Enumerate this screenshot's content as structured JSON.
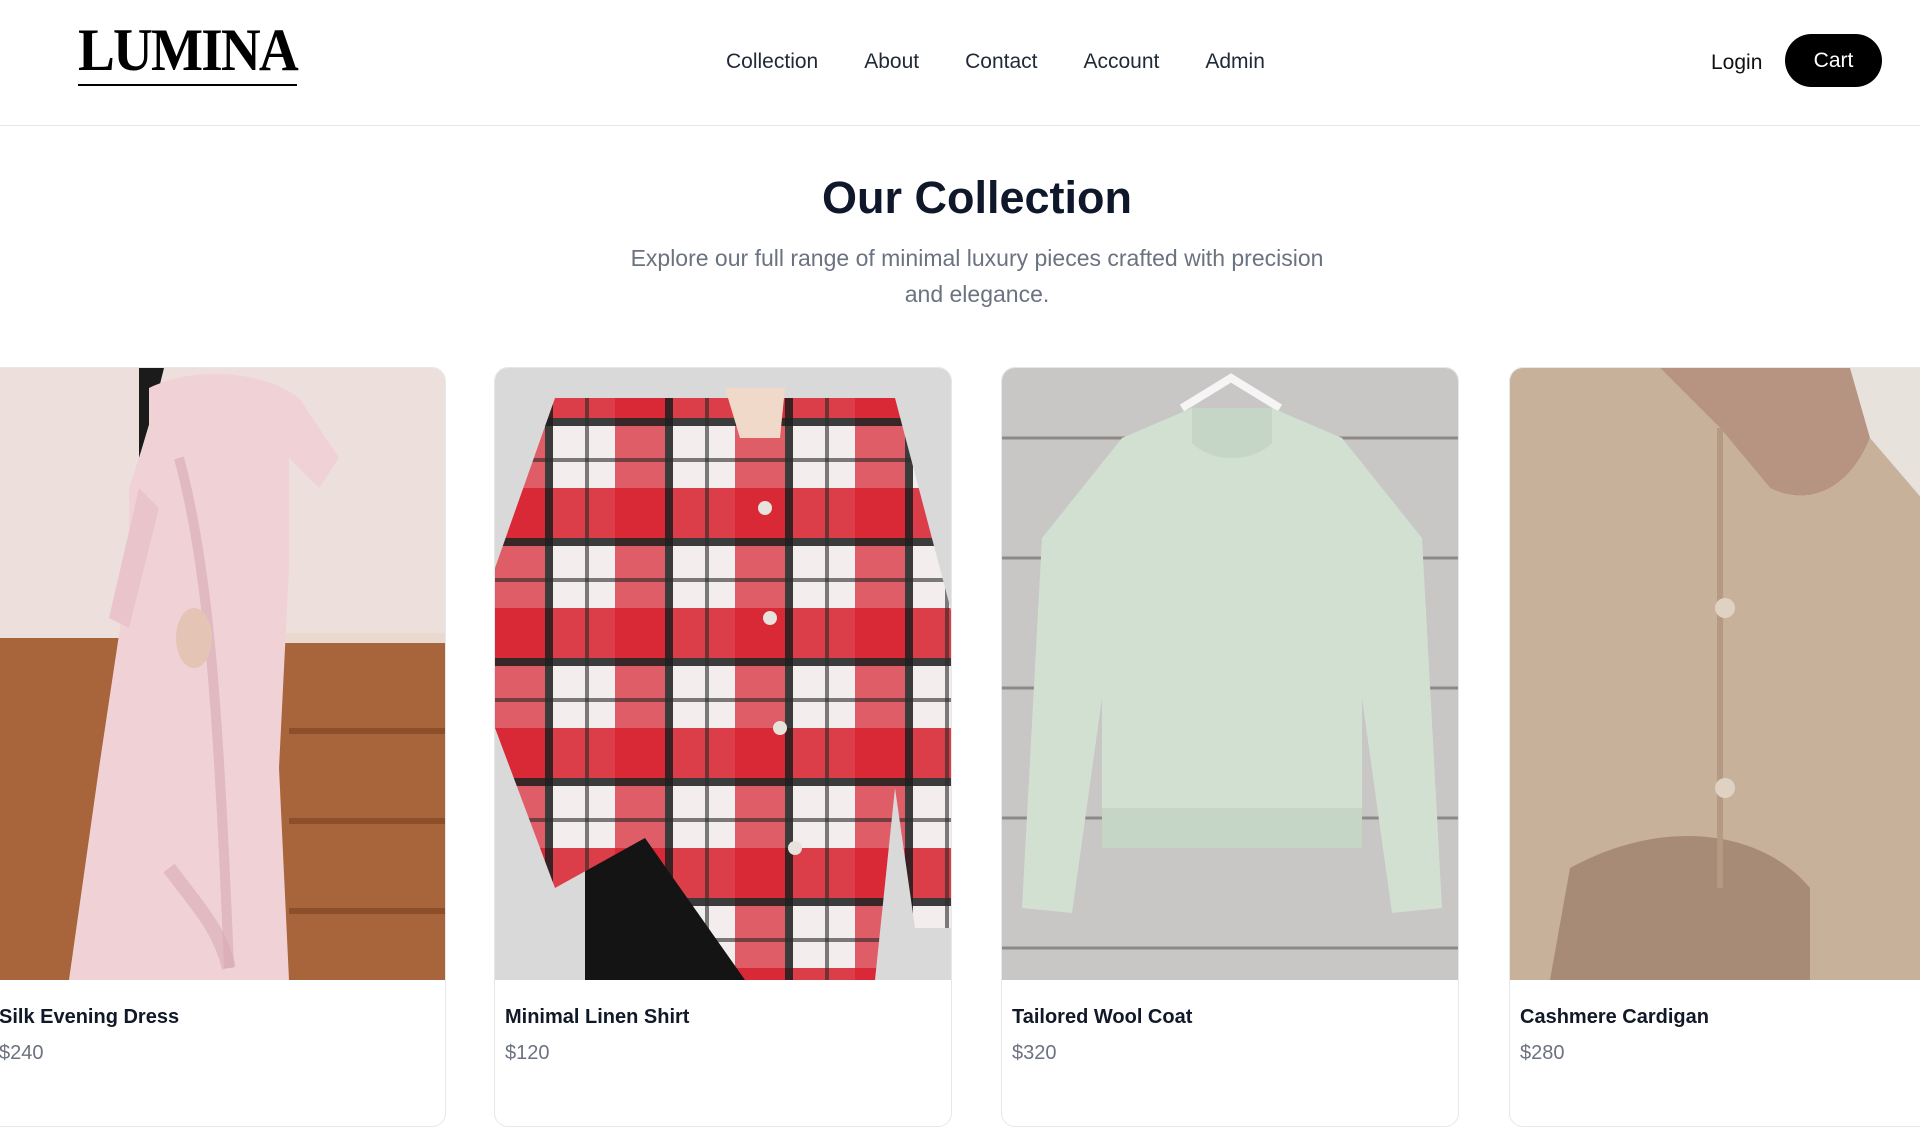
{
  "brand": {
    "logo_text": "LUMINA"
  },
  "nav": {
    "items": [
      {
        "label": "Collection"
      },
      {
        "label": "About"
      },
      {
        "label": "Contact"
      },
      {
        "label": "Account"
      },
      {
        "label": "Admin"
      }
    ],
    "login_label": "Login",
    "cart_label": "Cart"
  },
  "hero": {
    "title": "Our Collection",
    "subtitle": "Explore our full range of minimal luxury pieces crafted with precision and elegance."
  },
  "products": [
    {
      "name": "Silk Evening Dress",
      "price": "$240",
      "image": "pink-silk-dress-photo"
    },
    {
      "name": "Minimal Linen Shirt",
      "price": "$120",
      "image": "red-plaid-shirt-photo"
    },
    {
      "name": "Tailored Wool Coat",
      "price": "$320",
      "image": "mint-sweater-on-hanger-photo"
    },
    {
      "name": "Cashmere Cardigan",
      "price": "$280",
      "image": "beige-knit-cardigan-photo"
    }
  ],
  "colors": {
    "accent": "#000000",
    "title": "#0f172a",
    "muted": "#6b7280"
  }
}
